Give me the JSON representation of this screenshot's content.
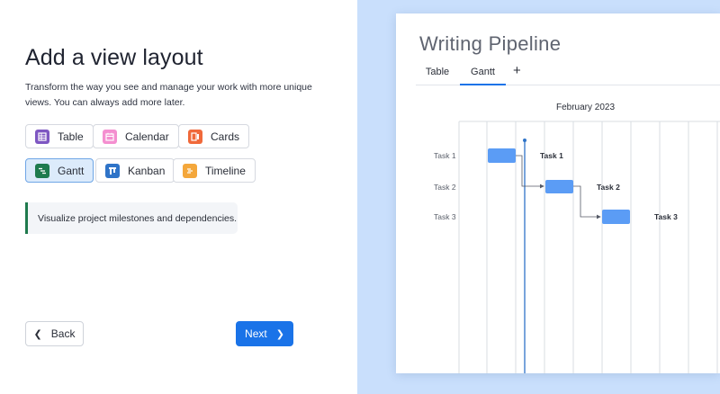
{
  "left": {
    "title": "Add a view layout",
    "subtitle": "Transform the way you see and manage your work with more unique views. You can always add more later.",
    "options": [
      {
        "label": "Table",
        "icon": "table-icon",
        "color": "#7e57c2"
      },
      {
        "label": "Calendar",
        "icon": "calendar-icon",
        "color": "#f48fd0"
      },
      {
        "label": "Cards",
        "icon": "cards-icon",
        "color": "#f0693a"
      },
      {
        "label": "Gantt",
        "icon": "gantt-icon",
        "color": "#1e7b4e",
        "selected": true
      },
      {
        "label": "Kanban",
        "icon": "kanban-icon",
        "color": "#2f74c8"
      },
      {
        "label": "Timeline",
        "icon": "timeline-icon",
        "color": "#f4a73b"
      }
    ],
    "callout": "Visualize project milestones and dependencies.",
    "back_label": "Back",
    "next_label": "Next"
  },
  "preview": {
    "title": "Writing Pipeline",
    "tabs": [
      {
        "label": "Table"
      },
      {
        "label": "Gantt",
        "active": true
      }
    ],
    "add_tab": "+",
    "month": "February 2023",
    "rows": [
      {
        "label": "Task 1",
        "bar_label": "Task 1"
      },
      {
        "label": "Task 2",
        "bar_label": "Task 2"
      },
      {
        "label": "Task 3",
        "bar_label": "Task 3"
      }
    ],
    "colors": {
      "bar": "#5b9cf5",
      "today": "#2f74c8",
      "accent": "#1a73e8"
    }
  }
}
